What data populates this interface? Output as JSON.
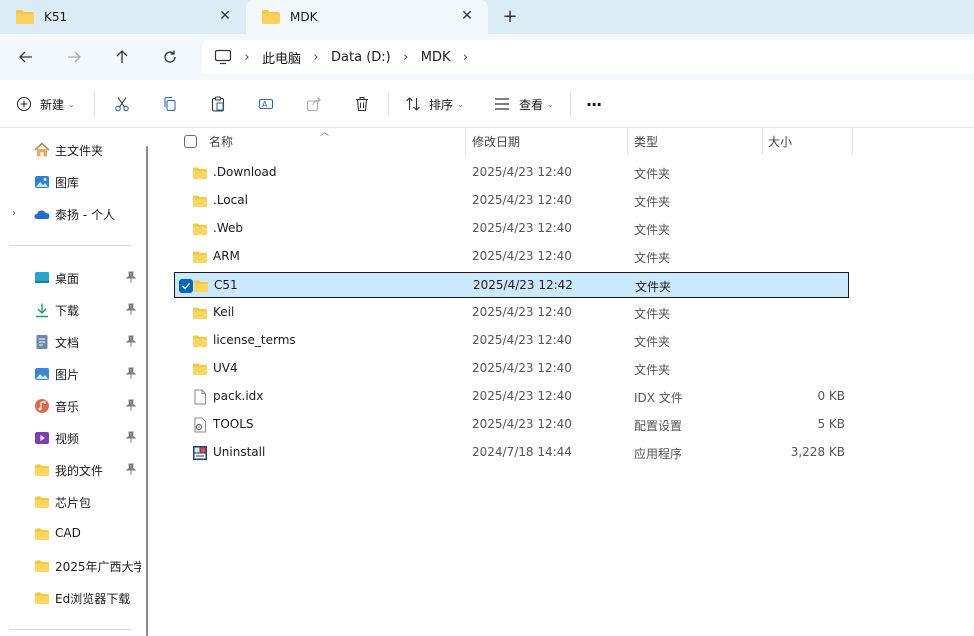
{
  "tabs": [
    {
      "label": "K51",
      "close": "✕"
    },
    {
      "label": "MDK",
      "close": "✕"
    }
  ],
  "new_tab": "+",
  "breadcrumbs": [
    "此电脑",
    "Data (D:)",
    "MDK"
  ],
  "commands": {
    "new": "新建",
    "sort": "排序",
    "view": "查看",
    "more": "···"
  },
  "sidebar": {
    "top_items": [
      {
        "label": "主文件夹",
        "icon": "home-icon"
      },
      {
        "label": "图库",
        "icon": "gallery-icon"
      },
      {
        "label": "泰扬 - 个人",
        "icon": "onedrive-icon"
      }
    ],
    "pinned_items": [
      {
        "label": "桌面",
        "icon": "desktop-icon",
        "pinned": true
      },
      {
        "label": "下载",
        "icon": "download-icon",
        "pinned": true
      },
      {
        "label": "文档",
        "icon": "document-icon",
        "pinned": true
      },
      {
        "label": "图片",
        "icon": "pictures-icon",
        "pinned": true
      },
      {
        "label": "音乐",
        "icon": "music-icon",
        "pinned": true
      },
      {
        "label": "视频",
        "icon": "video-icon",
        "pinned": true
      },
      {
        "label": "我的文件",
        "icon": "folder-icon",
        "pinned": true
      },
      {
        "label": "芯片包",
        "icon": "folder-icon",
        "pinned": false
      },
      {
        "label": "CAD",
        "icon": "folder-icon",
        "pinned": false
      },
      {
        "label": "2025年广西大学",
        "icon": "folder-icon",
        "pinned": false
      },
      {
        "label": "Ed浏览器下载",
        "icon": "folder-icon",
        "pinned": false
      }
    ]
  },
  "columns": {
    "name": "名称",
    "date": "修改日期",
    "type": "类型",
    "size": "大小"
  },
  "files": [
    {
      "name": ".Download",
      "date": "2025/4/23 12:40",
      "type": "文件夹",
      "size": "",
      "icon": "folder-icon",
      "selected": false
    },
    {
      "name": ".Local",
      "date": "2025/4/23 12:40",
      "type": "文件夹",
      "size": "",
      "icon": "folder-icon",
      "selected": false
    },
    {
      "name": ".Web",
      "date": "2025/4/23 12:40",
      "type": "文件夹",
      "size": "",
      "icon": "folder-icon",
      "selected": false
    },
    {
      "name": "ARM",
      "date": "2025/4/23 12:40",
      "type": "文件夹",
      "size": "",
      "icon": "folder-icon",
      "selected": false
    },
    {
      "name": "C51",
      "date": "2025/4/23 12:42",
      "type": "文件夹",
      "size": "",
      "icon": "folder-icon",
      "selected": true
    },
    {
      "name": "Keil",
      "date": "2025/4/23 12:40",
      "type": "文件夹",
      "size": "",
      "icon": "folder-icon",
      "selected": false
    },
    {
      "name": "license_terms",
      "date": "2025/4/23 12:40",
      "type": "文件夹",
      "size": "",
      "icon": "folder-icon",
      "selected": false
    },
    {
      "name": "UV4",
      "date": "2025/4/23 12:40",
      "type": "文件夹",
      "size": "",
      "icon": "folder-icon",
      "selected": false
    },
    {
      "name": "pack.idx",
      "date": "2025/4/23 12:40",
      "type": "IDX 文件",
      "size": "0 KB",
      "icon": "file-icon",
      "selected": false
    },
    {
      "name": "TOOLS",
      "date": "2025/4/23 12:40",
      "type": "配置设置",
      "size": "5 KB",
      "icon": "settings-file-icon",
      "selected": false
    },
    {
      "name": "Uninstall",
      "date": "2024/7/18 14:44",
      "type": "应用程序",
      "size": "3,228 KB",
      "icon": "app-icon",
      "selected": false
    }
  ],
  "colors": {
    "titlebar": "#dcecf6",
    "selection": "#cce8ff",
    "accent": "#0067c0",
    "folder": "#f8c642"
  }
}
